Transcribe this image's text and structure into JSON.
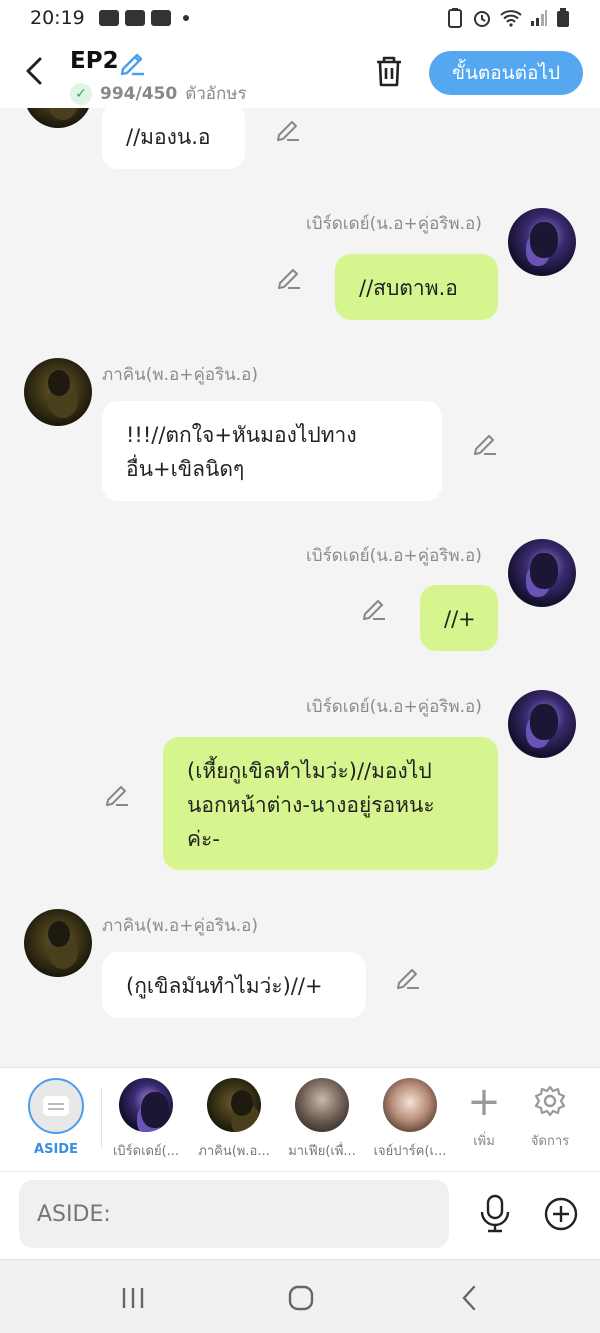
{
  "status_bar": {
    "time": "20:19"
  },
  "header": {
    "title": "EP2",
    "char_count": "994/450",
    "char_unit": "ตัวอักษร",
    "next_button": "ขั้นตอนต่อไป"
  },
  "messages": [
    {
      "side": "left",
      "text": "//มองน.อ"
    },
    {
      "side": "right",
      "sender": "เบิร์ดเดย์(น.อ+คู่อริพ.อ)",
      "text": "//สบตาพ.อ"
    },
    {
      "side": "left",
      "sender": "ภาคิน(พ.อ+คู่อริน.อ)",
      "line1": "!!!//ตกใจ+หันมองไปทาง",
      "line2": "อื่น+เขิลนิดๆ"
    },
    {
      "side": "right",
      "sender": "เบิร์ดเดย์(น.อ+คู่อริพ.อ)",
      "text": "//+"
    },
    {
      "side": "right",
      "sender": "เบิร์ดเดย์(น.อ+คู่อริพ.อ)",
      "line1": "(เหี้ยกูเขิลทำไมว่ะ)//มองไป",
      "line2": "นอกหน้าต่าง-นางอยู่รอหนะ",
      "line3": "ค่ะ-"
    },
    {
      "side": "left",
      "sender": "ภาคิน(พ.อ+คู่อริน.อ)",
      "text": "(กูเขิลมันทำไมว่ะ)//+"
    }
  ],
  "characters": [
    {
      "label": "ASIDE"
    },
    {
      "label": "เบิร์ดเดย์(..."
    },
    {
      "label": "ภาคิน(พ.อ..."
    },
    {
      "label": "มาเฟีย(เพื่..."
    },
    {
      "label": "เจย์ปาร์ค(เ..."
    }
  ],
  "tools": {
    "add_label": "เพิ่ม",
    "manage_label": "จัดการ"
  },
  "input": {
    "placeholder": "ASIDE:"
  },
  "colors": {
    "accent": "#55a8f0",
    "green_bubble": "#d6f58e",
    "aside_ring": "#4a9ef0"
  }
}
